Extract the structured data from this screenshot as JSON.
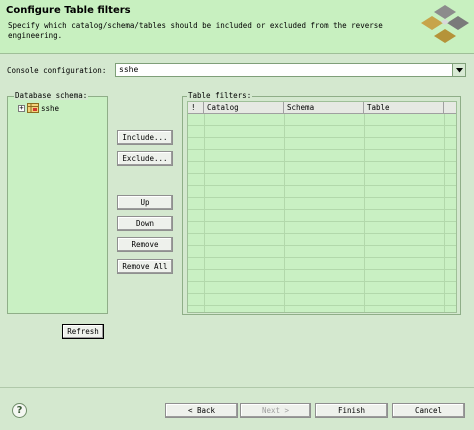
{
  "header": {
    "title": "Configure Table filters",
    "description": "Specify which catalog/schema/tables should be included or excluded from the reverse engineering.",
    "logo_icon": "hibernate-logo-icon"
  },
  "console": {
    "label": "Console configuration:",
    "value": "sshe"
  },
  "schema": {
    "legend": "Database schema:",
    "items": [
      {
        "expander": "+",
        "label": "sshe",
        "icon": "database-icon"
      }
    ]
  },
  "actions": {
    "include": "Include...",
    "exclude": "Exclude...",
    "up": "Up",
    "down": "Down",
    "remove": "Remove",
    "remove_all": "Remove All",
    "refresh": "Refresh"
  },
  "filters": {
    "legend": "Table filters:",
    "columns": [
      "!",
      "Catalog",
      "Schema",
      "Table"
    ],
    "rows": []
  },
  "footer": {
    "help_icon": "help-icon",
    "back": "< Back",
    "next": "Next >",
    "finish": "Finish",
    "cancel": "Cancel"
  },
  "colors": {
    "background": "#d4e8cf",
    "header": "#c8f0c0",
    "panel": "#c9f0c3"
  }
}
